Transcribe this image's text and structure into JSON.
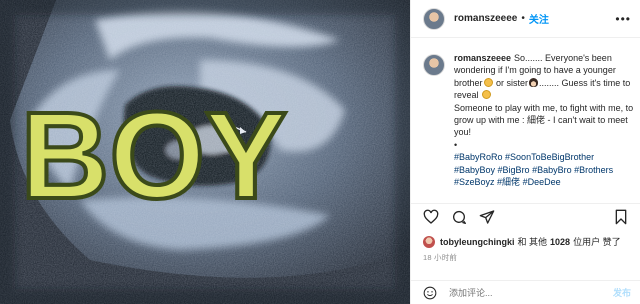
{
  "image": {
    "overlay_label": "BOY",
    "kind": "ultrasound scan",
    "overlay_color": "#d8e06a"
  },
  "header": {
    "username": "romanszeeee",
    "separator": "•",
    "follow_label": "关注",
    "more_icon": "more-horizontal-icon"
  },
  "caption": {
    "username": "romanszeeee",
    "text_1": "So....... Everyone's been wondering if I'm going to have a younger brother",
    "text_2": " or sister",
    "text_3": "........ Guess it's time to reveal ",
    "text_4": "Someone to play with me, to fight with me, to grow up with me : 細佬 - I can't wait to meet you!",
    "bullet": "•",
    "hashtags": [
      "#BabyRoRo",
      "#SoonToBeBigBrother",
      "#BabyBoy",
      "#BigBro",
      "#BabyBro",
      "#Brothers",
      "#SzeBoyz",
      "#細佬",
      "#DeeDee"
    ]
  },
  "likes": {
    "liker": "tobyleungchingki",
    "and_others": "和 其他",
    "count": "1028",
    "suffix": "位用户 赞了"
  },
  "timestamp": "18 小时前",
  "comment": {
    "placeholder": "添加评论...",
    "post_label": "发布"
  },
  "colors": {
    "link_blue": "#0095f6",
    "hashtag": "#00376b",
    "muted": "#8e8e8e"
  }
}
